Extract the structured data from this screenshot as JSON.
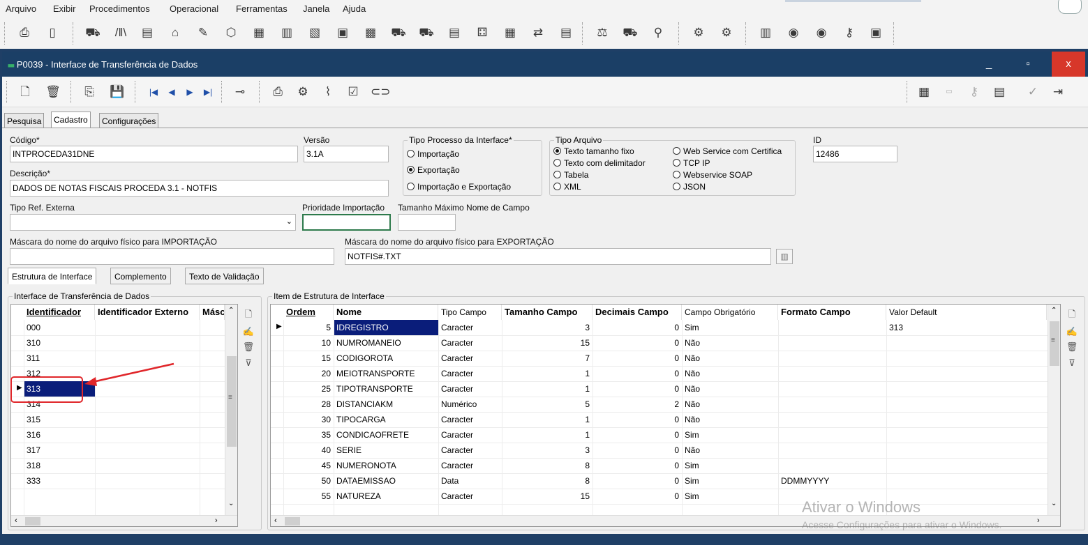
{
  "menu": [
    "Arquivo",
    "Exibir",
    "Procedimentos",
    "Operacional",
    "Ferramentas",
    "Janela",
    "Ajuda"
  ],
  "window": {
    "title": "P0039 - Interface de Transferência de Dados",
    "minimize": "_",
    "maximize": "▫",
    "close": "x"
  },
  "tabs": [
    "Pesquisa",
    "Cadastro",
    "Configurações"
  ],
  "form": {
    "codigo_label": "Código*",
    "codigo_value": "INTPROCEDA31DNE",
    "versao_label": "Versão",
    "versao_value": "3.1A",
    "descricao_label": "Descrição*",
    "descricao_value": "DADOS DE NOTAS FISCAIS PROCEDA 3.1 - NOTFIS",
    "tipo_processo_label": "Tipo Processo da Interface*",
    "tipo_processo_options": [
      "Importação",
      "Exportação",
      "Importação e Exportação"
    ],
    "tipo_processo_selected": 1,
    "tipo_arquivo_label": "Tipo Arquivo",
    "tipo_arquivo_options_left": [
      "Texto tamanho fixo",
      "Texto com delimitador",
      "Tabela",
      "XML"
    ],
    "tipo_arquivo_options_right": [
      "Web Service com Certifica",
      "TCP IP",
      "Webservice SOAP",
      "JSON"
    ],
    "tipo_arquivo_selected": "Texto tamanho fixo",
    "id_label": "ID",
    "id_value": "12486",
    "tipo_ref_label": "Tipo Ref. Externa",
    "tipo_ref_value": "",
    "prioridade_label": "Prioridade Importação",
    "prioridade_value": "",
    "tamanho_label": "Tamanho Máximo Nome de Campo",
    "tamanho_value": "",
    "mascara_imp_label": "Máscara do nome do arquivo físico para IMPORTAÇÃO",
    "mascara_imp_value": "",
    "mascara_exp_label": "Máscara do nome do arquivo físico para EXPORTAÇÃO",
    "mascara_exp_value": "NOTFIS#.TXT"
  },
  "subtabs": [
    "Estrutura de Interface",
    "Complemento",
    "Texto de Validação"
  ],
  "left_grid": {
    "title": "Interface de Transferência de Dados",
    "headers": [
      "Identificador",
      "Identificador Externo",
      "Másc"
    ],
    "rows": [
      "000",
      "310",
      "311",
      "312",
      "313",
      "314",
      "315",
      "316",
      "317",
      "318",
      "333"
    ],
    "selected_index": 4
  },
  "right_grid": {
    "title": "Item de Estrutura de Interface",
    "headers": [
      "Ordem",
      "Nome",
      "Tipo Campo",
      "Tamanho Campo",
      "Decimais Campo",
      "Campo Obrigatório",
      "Formato Campo",
      "Valor Default"
    ],
    "rows": [
      {
        "ordem": "5",
        "nome": "IDREGISTRO",
        "tipo": "Caracter",
        "tamanho": "3",
        "decimais": "0",
        "obrig": "Sim",
        "formato": "",
        "default": "313"
      },
      {
        "ordem": "10",
        "nome": "NUMROMANEIO",
        "tipo": "Caracter",
        "tamanho": "15",
        "decimais": "0",
        "obrig": "Não",
        "formato": "",
        "default": ""
      },
      {
        "ordem": "15",
        "nome": "CODIGOROTA",
        "tipo": "Caracter",
        "tamanho": "7",
        "decimais": "0",
        "obrig": "Não",
        "formato": "",
        "default": ""
      },
      {
        "ordem": "20",
        "nome": "MEIOTRANSPORTE",
        "tipo": "Caracter",
        "tamanho": "1",
        "decimais": "0",
        "obrig": "Não",
        "formato": "",
        "default": ""
      },
      {
        "ordem": "25",
        "nome": "TIPOTRANSPORTE",
        "tipo": "Caracter",
        "tamanho": "1",
        "decimais": "0",
        "obrig": "Não",
        "formato": "",
        "default": ""
      },
      {
        "ordem": "28",
        "nome": "DISTANCIAKM",
        "tipo": "Numérico",
        "tamanho": "5",
        "decimais": "2",
        "obrig": "Não",
        "formato": "",
        "default": ""
      },
      {
        "ordem": "30",
        "nome": "TIPOCARGA",
        "tipo": "Caracter",
        "tamanho": "1",
        "decimais": "0",
        "obrig": "Não",
        "formato": "",
        "default": ""
      },
      {
        "ordem": "35",
        "nome": "CONDICAOFRETE",
        "tipo": "Caracter",
        "tamanho": "1",
        "decimais": "0",
        "obrig": "Sim",
        "formato": "",
        "default": ""
      },
      {
        "ordem": "40",
        "nome": "SERIE",
        "tipo": "Caracter",
        "tamanho": "3",
        "decimais": "0",
        "obrig": "Não",
        "formato": "",
        "default": ""
      },
      {
        "ordem": "45",
        "nome": "NUMERONOTA",
        "tipo": "Caracter",
        "tamanho": "8",
        "decimais": "0",
        "obrig": "Sim",
        "formato": "",
        "default": ""
      },
      {
        "ordem": "50",
        "nome": "DATAEMISSAO",
        "tipo": "Data",
        "tamanho": "8",
        "decimais": "0",
        "obrig": "Sim",
        "formato": "DDMMYYYY",
        "default": ""
      },
      {
        "ordem": "55",
        "nome": "NATUREZA",
        "tipo": "Caracter",
        "tamanho": "15",
        "decimais": "0",
        "obrig": "Sim",
        "formato": "",
        "default": ""
      }
    ],
    "selected_index": 0
  },
  "watermark": {
    "line1": "Ativar o Windows",
    "line2": "Acesse Configurações para ativar o Windows."
  },
  "colors": {
    "titlebar": "#1b3f66",
    "close": "#d7372a",
    "selection": "#0a1d7a",
    "annotation": "#e0262a"
  }
}
